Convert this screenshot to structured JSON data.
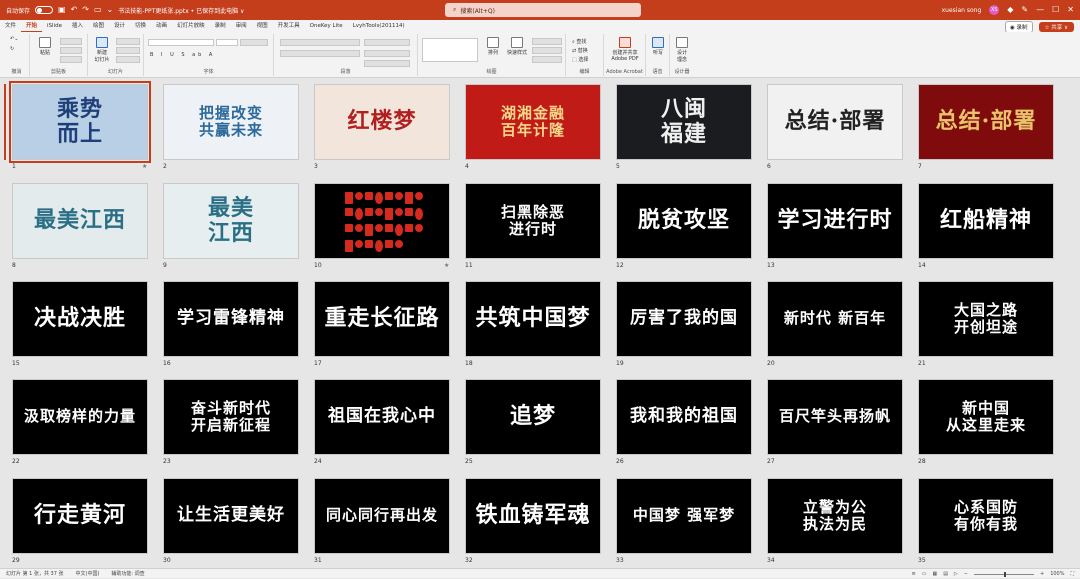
{
  "titlebar": {
    "autosave": "自动保存",
    "toggle_state": "关",
    "doc_name": "书法技能-PPT更纸张.pptx • 已保存到此电脑 ∨",
    "search_placeholder": "搜索(Alt+Q)",
    "user_name": "xuesian song",
    "user_initials": "XS"
  },
  "menubar": {
    "items": [
      "文件",
      "开始",
      "iSlide",
      "插入",
      "绘图",
      "设计",
      "切换",
      "动画",
      "幻灯片放映",
      "录制",
      "审阅",
      "视图",
      "开发工具",
      "OneKey Lite",
      "LvyhTools(201114)"
    ],
    "active_index": 1,
    "record_label": "◉ 录制",
    "share_label": "☆ 共享 ∨"
  },
  "ribbon": {
    "groups": [
      {
        "label": "撤消"
      },
      {
        "label": "剪贴板"
      },
      {
        "label": "幻灯片"
      },
      {
        "label": "字体"
      },
      {
        "label": "段落"
      },
      {
        "label": "绘图"
      },
      {
        "label": "编辑"
      },
      {
        "label": "Adobe Acrobat"
      },
      {
        "label": "语音"
      },
      {
        "label": "设计器"
      }
    ],
    "paste_label": "粘贴",
    "new_slide_label": "新建\n幻灯片",
    "arrange_label": "排列",
    "quick_style_label": "快速样式",
    "find_label": "查找",
    "replace_label": "替换",
    "select_label": "选择",
    "pdf_label": "创建并共享\nAdobe PDF",
    "dictate_label": "听写",
    "designer_label": "设计\n理念"
  },
  "slides": [
    {
      "num": "1",
      "title": "乘势\n而上",
      "bg": "#b9cfe6",
      "fg": "#1f3f78",
      "star": true
    },
    {
      "num": "2",
      "title": "把握改变\n共赢未来",
      "bg": "#eef2f6",
      "fg": "#2c6a9c",
      "star": false
    },
    {
      "num": "3",
      "title": "红楼梦",
      "bg": "#f2e6dc",
      "fg": "#b21f1f",
      "star": false
    },
    {
      "num": "4",
      "title": "湖湘金融\n百年计隆",
      "bg": "#c11b17",
      "fg": "#f5d78a",
      "star": false
    },
    {
      "num": "5",
      "title": "八闽\n福建",
      "bg": "#1a1c20",
      "fg": "#f0f0f0",
      "star": false
    },
    {
      "num": "6",
      "title": "总结·部署",
      "bg": "#f1f1f1",
      "fg": "#222222",
      "star": false
    },
    {
      "num": "7",
      "title": "总结·部署",
      "bg": "#7f0b0d",
      "fg": "#e8c36a",
      "star": false
    },
    {
      "num": "8",
      "title": "最美江西",
      "bg": "#e3ebec",
      "fg": "#2a6f86",
      "star": false
    },
    {
      "num": "9",
      "title": "最美\n江西",
      "bg": "#e7eef0",
      "fg": "#2a6f86",
      "star": false
    },
    {
      "num": "10",
      "title": "",
      "bg": "#000000",
      "fg": "#d62a1f",
      "star": true
    },
    {
      "num": "11",
      "title": "扫黑除恶\n进行时",
      "bg": "#000000",
      "fg": "#ffffff",
      "star": false
    },
    {
      "num": "12",
      "title": "脱贫攻坚",
      "bg": "#000000",
      "fg": "#ffffff",
      "star": false
    },
    {
      "num": "13",
      "title": "学习进行时",
      "bg": "#000000",
      "fg": "#ffffff",
      "star": false
    },
    {
      "num": "14",
      "title": "红船精神",
      "bg": "#000000",
      "fg": "#ffffff",
      "star": false
    },
    {
      "num": "15",
      "title": "决战决胜",
      "bg": "#000000",
      "fg": "#ffffff",
      "star": false
    },
    {
      "num": "16",
      "title": "学习雷锋精神",
      "bg": "#000000",
      "fg": "#ffffff",
      "star": false
    },
    {
      "num": "17",
      "title": "重走长征路",
      "bg": "#000000",
      "fg": "#ffffff",
      "star": false
    },
    {
      "num": "18",
      "title": "共筑中国梦",
      "bg": "#000000",
      "fg": "#ffffff",
      "star": false
    },
    {
      "num": "19",
      "title": "厉害了我的国",
      "bg": "#000000",
      "fg": "#ffffff",
      "star": false
    },
    {
      "num": "20",
      "title": "新时代 新百年",
      "bg": "#000000",
      "fg": "#ffffff",
      "star": false
    },
    {
      "num": "21",
      "title": "大国之路\n开创坦途",
      "bg": "#000000",
      "fg": "#ffffff",
      "star": false
    },
    {
      "num": "22",
      "title": "汲取榜样的力量",
      "bg": "#000000",
      "fg": "#ffffff",
      "star": false
    },
    {
      "num": "23",
      "title": "奋斗新时代\n开启新征程",
      "bg": "#000000",
      "fg": "#ffffff",
      "star": false
    },
    {
      "num": "24",
      "title": "祖国在我心中",
      "bg": "#000000",
      "fg": "#ffffff",
      "star": false
    },
    {
      "num": "25",
      "title": "追梦",
      "bg": "#000000",
      "fg": "#ffffff",
      "star": false
    },
    {
      "num": "26",
      "title": "我和我的祖国",
      "bg": "#000000",
      "fg": "#ffffff",
      "star": false
    },
    {
      "num": "27",
      "title": "百尺竿头再扬帆",
      "bg": "#000000",
      "fg": "#ffffff",
      "star": false
    },
    {
      "num": "28",
      "title": "新中国\n从这里走来",
      "bg": "#000000",
      "fg": "#ffffff",
      "star": false
    },
    {
      "num": "29",
      "title": "行走黄河",
      "bg": "#000000",
      "fg": "#ffffff",
      "star": false
    },
    {
      "num": "30",
      "title": "让生活更美好",
      "bg": "#000000",
      "fg": "#ffffff",
      "star": false
    },
    {
      "num": "31",
      "title": "同心同行再出发",
      "bg": "#000000",
      "fg": "#ffffff",
      "star": false
    },
    {
      "num": "32",
      "title": "铁血铸军魂",
      "bg": "#000000",
      "fg": "#ffffff",
      "star": false
    },
    {
      "num": "33",
      "title": "中国梦 强军梦",
      "bg": "#000000",
      "fg": "#ffffff",
      "star": false
    },
    {
      "num": "34",
      "title": "立警为公\n执法为民",
      "bg": "#000000",
      "fg": "#ffffff",
      "star": false
    },
    {
      "num": "35",
      "title": "心系国防\n有你有我",
      "bg": "#000000",
      "fg": "#ffffff",
      "star": false
    }
  ],
  "statusbar": {
    "slide_info": "幻灯片 第 1 张，共 37 张",
    "language": "中文(中国)",
    "accessibility": "辅助功能: 调查",
    "zoom": "100%"
  },
  "colors": {
    "accent": "#c43e1c",
    "ribbon": "#f3f3f3",
    "workspace": "#e6e6e6"
  }
}
